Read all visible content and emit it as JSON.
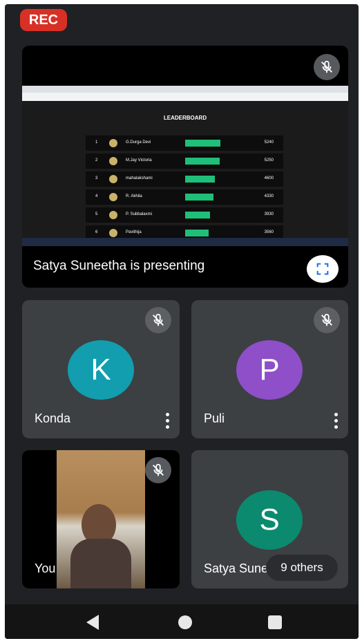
{
  "rec_label": "REC",
  "presentation": {
    "label": "Satya Suneetha  is presenting",
    "mic_icon": "mic-off-icon",
    "fullscreen_icon": "fullscreen-icon",
    "leaderboard": {
      "title": "LEADERBOARD",
      "rows": [
        {
          "rank": "1",
          "name": "G.Durga Devi",
          "score": "5240",
          "bar": 0.85
        },
        {
          "rank": "2",
          "name": "M.Jay Victoria",
          "score": "5250",
          "bar": 0.83
        },
        {
          "rank": "3",
          "name": "mahalakshami",
          "score": "4600",
          "bar": 0.72
        },
        {
          "rank": "4",
          "name": "R. Akhila",
          "score": "4330",
          "bar": 0.68
        },
        {
          "rank": "5",
          "name": "P. Subbalaxmi",
          "score": "3930",
          "bar": 0.6
        },
        {
          "rank": "6",
          "name": "Pavithija",
          "score": "3560",
          "bar": 0.57
        }
      ]
    }
  },
  "participants": {
    "konda": {
      "initial": "K",
      "name": "Konda",
      "color": "#129eaf"
    },
    "puli": {
      "initial": "P",
      "name": "Puli",
      "color": "#8e4fc9"
    },
    "you": {
      "name": "You"
    },
    "satya": {
      "initial": "S",
      "name": "Satya Sune",
      "color": "#0b8a6f"
    }
  },
  "others_label": "9 others"
}
